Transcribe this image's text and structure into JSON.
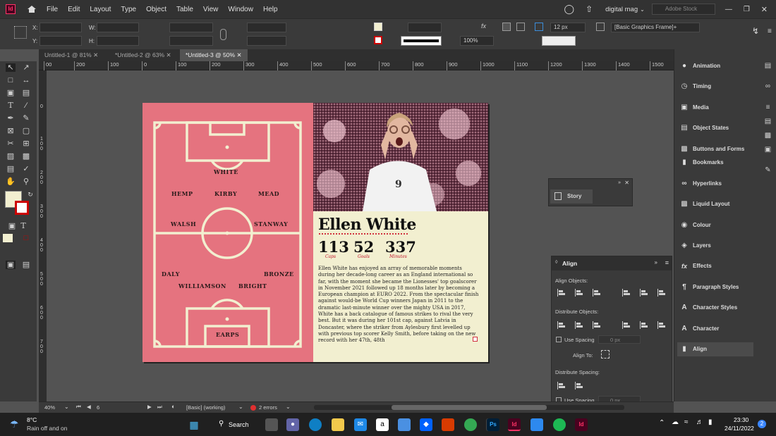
{
  "menubar": {
    "items": [
      "File",
      "Edit",
      "Layout",
      "Type",
      "Object",
      "Table",
      "View",
      "Window",
      "Help"
    ],
    "workspace": "digital mag",
    "search_placeholder": "Adobe Stock"
  },
  "controlbar": {
    "x_label": "X:",
    "y_label": "Y:",
    "w_label": "W:",
    "h_label": "H:",
    "zoom": "100%",
    "stroke": "12 px",
    "frame_style": "[Basic Graphics Frame]+"
  },
  "tabs": [
    {
      "label": "Untitled-1 @ 81%",
      "active": false
    },
    {
      "label": "*Untitled-2 @ 63%",
      "active": false
    },
    {
      "label": "*Untitled-3 @ 50%",
      "active": true
    }
  ],
  "ruler_h": [
    "00",
    "200",
    "100",
    "0",
    "100",
    "200",
    "300",
    "400",
    "500",
    "600",
    "700",
    "800",
    "900",
    "1000",
    "1100",
    "1200",
    "1300",
    "1400",
    "1500"
  ],
  "ruler_v": [
    "0",
    "1 0 0",
    "2 0 0",
    "3 0 0",
    "4 0 0",
    "5 0 0",
    "6 0 0",
    "7 0 0"
  ],
  "pitch": {
    "players": [
      "WHITE",
      "HEMP",
      "KIRBY",
      "MEAD",
      "WALSH",
      "STANWAY",
      "DALY",
      "BRONZE",
      "WILLIAMSON",
      "BRIGHT",
      "EARPS"
    ]
  },
  "article": {
    "name": "Ellen White",
    "stats": [
      {
        "value": "113",
        "label": "Caps"
      },
      {
        "value": "52",
        "label": "Goals"
      },
      {
        "value": "337",
        "label": "Minutes"
      }
    ],
    "shirt_number": "9",
    "bio": "Ellen White has enjoyed an array of memorable moments during her decade-long career as an England international so far, with the moment she became the Lionesses' top goalscorer in November 2021 followed up 18 months later by becoming a European champion at EURO 2022. From the spectacular finish against would-be World Cup winners Japan in 2011 to the dramatic last-minute winner over the mighty USA in 2017, White has a back catalogue of famous strikes to rival the very best. But it was during her 101st cap, against Latvia in Doncaster, where the striker from Aylesbury first levelled up with previous top scorer Kelly Smith, before taking on the new record with her 47th, 48th"
  },
  "panels": {
    "items": [
      "Animation",
      "Timing",
      "Media",
      "Object States",
      "Buttons and Forms",
      "Bookmarks",
      "Hyperlinks",
      "Liquid Layout",
      "Colour",
      "Layers",
      "Effects",
      "Paragraph Styles",
      "Character Styles",
      "Character",
      "Align"
    ],
    "selected": "Align"
  },
  "story_panel": {
    "title": "Story"
  },
  "align_panel": {
    "title": "Align",
    "align_objects": "Align Objects:",
    "distribute_objects": "Distribute Objects:",
    "use_spacing": "Use Spacing",
    "spacing_value": "0 px",
    "align_to": "Align To:",
    "distribute_spacing": "Distribute Spacing:"
  },
  "statusbar": {
    "zoom": "40%",
    "page": "6",
    "preflight_profile": "[Basic] (working)",
    "errors": "2 errors"
  },
  "taskbar": {
    "temperature": "8°C",
    "weather": "Rain off and on",
    "search": "Search",
    "time": "23:30",
    "date": "24/11/2022",
    "notifications": "2"
  },
  "colors": {
    "accent_pink": "#e5737f",
    "cream": "#f2efd0",
    "red_label": "#c0142a"
  }
}
